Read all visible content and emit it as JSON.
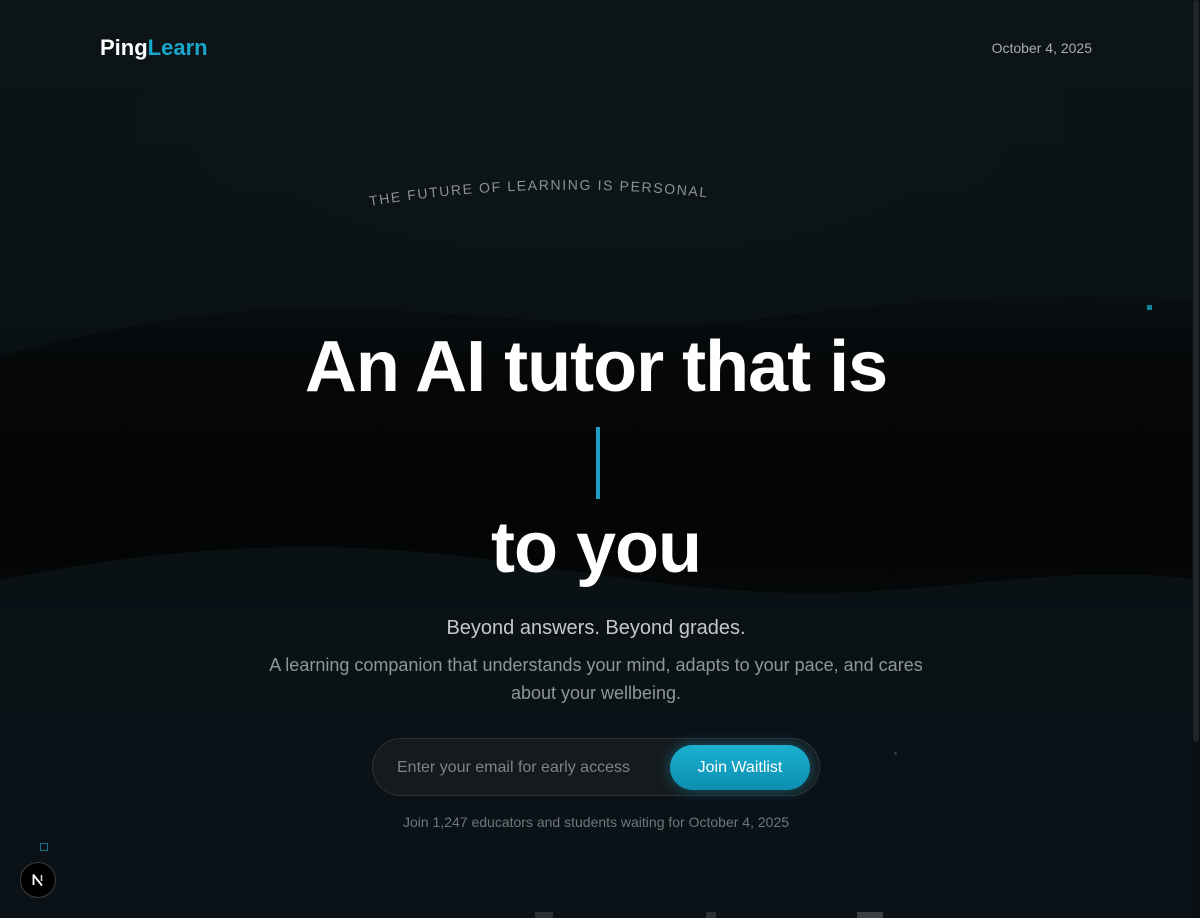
{
  "header": {
    "logo_part1": "Ping",
    "logo_part2": "Learn",
    "date": "October 4, 2025"
  },
  "hero": {
    "eyebrow": "THE FUTURE OF LEARNING IS PERSONAL",
    "headline_line1": "An AI tutor that is",
    "headline_line3": "to you",
    "tagline": "Beyond answers. Beyond grades.",
    "description": "A learning companion that understands your mind, adapts to your pace, and cares about your wellbeing."
  },
  "signup": {
    "email_placeholder": "Enter your email for early access",
    "button_label": "Join Waitlist",
    "note": "Join 1,247 educators and students waiting for October 4, 2025"
  },
  "badge": {
    "letter": "N"
  },
  "colors": {
    "accent": "#1aa6cc",
    "background": "#050607",
    "button": "#12a0c2"
  }
}
